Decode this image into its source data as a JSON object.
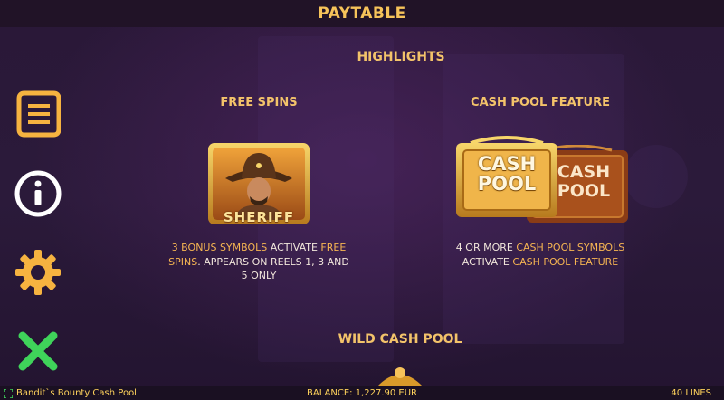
{
  "header": {
    "title": "PAYTABLE"
  },
  "section_title": "HIGHLIGHTS",
  "free_spins": {
    "heading": "FREE SPINS",
    "symbol_label": "SHERIFF",
    "desc_hl1": "3 BONUS SYMBOLS",
    "desc_1": " ACTIVATE ",
    "desc_hl2": "FREE SPINS",
    "desc_2": ". APPEARS ON REELS 1, 3 AND 5 ONLY"
  },
  "cash_pool": {
    "heading": "CASH POOL FEATURE",
    "symbol_line1": "CASH",
    "symbol_line2": "POOL",
    "desc_1": "4 OR MORE ",
    "desc_hl1": "CASH POOL SYMBOLS",
    "desc_2": " ACTIVATE ",
    "desc_hl2": "CASH POOL FEATURE"
  },
  "wild_heading": "WILD CASH POOL",
  "sidebar": {
    "icons": [
      "paytable-scroll-icon",
      "info-icon",
      "settings-gear-icon",
      "close-icon"
    ]
  },
  "status_bar": {
    "game_name": "Bandit`s Bounty Cash Pool",
    "balance": "BALANCE: 1,227.90 EUR",
    "lines": "40 LINES"
  },
  "colors": {
    "accent": "#f6c35a",
    "close": "#3fd35a",
    "background": "#241530"
  }
}
